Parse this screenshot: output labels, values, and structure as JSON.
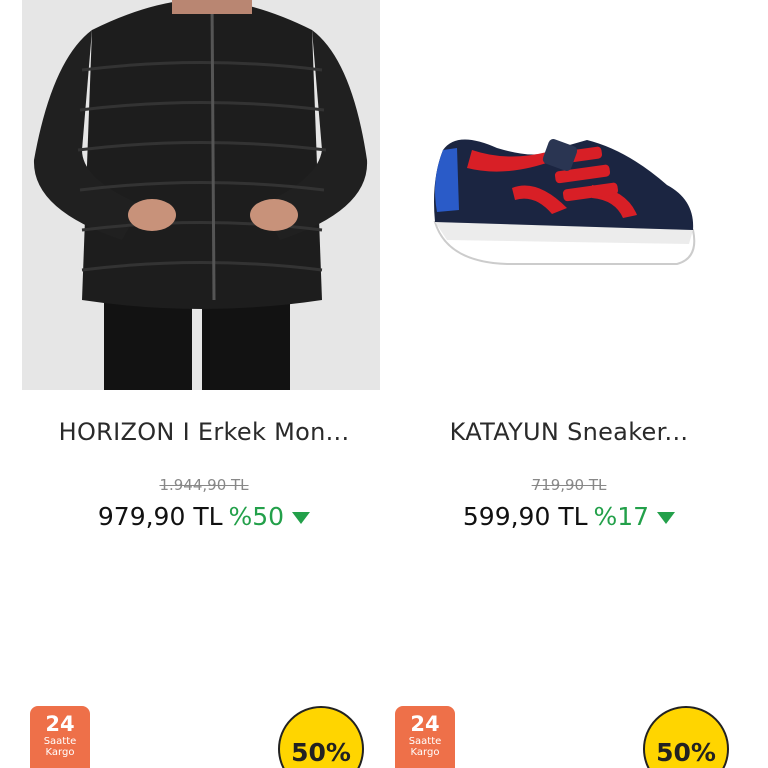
{
  "products": [
    {
      "title": "HORIZON I Erkek Mon...",
      "old_price": "1.944,90 TL",
      "price": "979,90 TL",
      "discount": "%50",
      "cargo_hours": "24",
      "cargo_label_1": "Saatte",
      "cargo_label_2": "Kargo",
      "badge": "50%",
      "image_icon": "puffer-jacket-image"
    },
    {
      "title": "KATAYUN Sneaker...",
      "old_price": "719,90 TL",
      "price": "599,90 TL",
      "discount": "%17",
      "cargo_hours": "24",
      "cargo_label_1": "Saatte",
      "cargo_label_2": "Kargo",
      "badge": "50%",
      "image_icon": "sneaker-image"
    }
  ],
  "colors": {
    "discount_green": "#23a04a",
    "cargo_orange": "#ee7049",
    "badge_yellow": "#ffd500"
  }
}
